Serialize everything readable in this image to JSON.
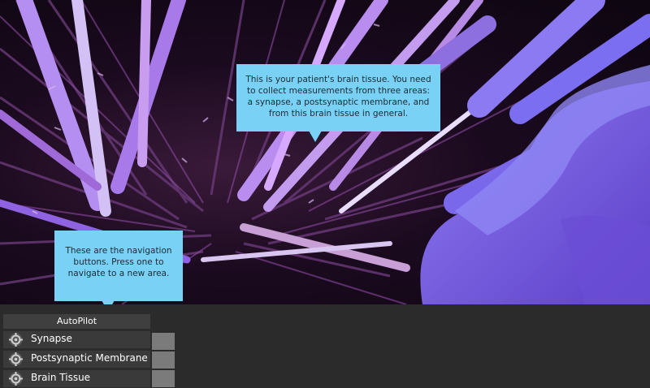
{
  "tooltips": {
    "brain_tissue": "This is your patient's brain tissue. You need to collect measurements from three areas: a synapse, a postsynaptic membrane, and from this brain tissue in general.",
    "navigation": "These are the navigation buttons. Press one to navigate to a new area."
  },
  "autopilot": {
    "header": "AutoPilot",
    "items": [
      {
        "label": "Synapse",
        "icon": "target-icon"
      },
      {
        "label": "Postsynaptic Membrane",
        "icon": "target-icon"
      },
      {
        "label": "Brain Tissue",
        "icon": "target-icon"
      }
    ]
  },
  "colors": {
    "callout": "#79d2f5",
    "panel": "#2b2b2b",
    "neuron_light": "#c9a2ff",
    "neuron_deep": "#7b5be0"
  }
}
